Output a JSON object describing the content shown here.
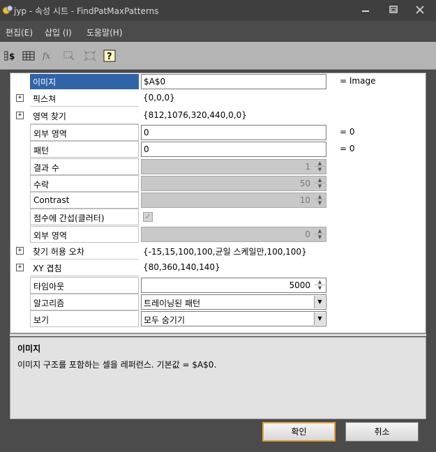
{
  "window": {
    "title": "jyp - 속성 시트 - FindPatMaxPatterns",
    "min_symbol": "─",
    "max_symbol": "▢",
    "close_symbol": "✕"
  },
  "menu": {
    "items": [
      {
        "label": "편집(E)"
      },
      {
        "label": "삽입 (I)"
      },
      {
        "label": "도움말(H)"
      }
    ]
  },
  "toolbar": {
    "buttons": [
      {
        "icon": "cell-reference-icon",
        "glyph": "$"
      },
      {
        "icon": "grid-icon",
        "glyph": "▦"
      },
      {
        "icon": "function-icon",
        "glyph": "ƒx"
      },
      {
        "icon": "select-region-icon",
        "glyph": "⬚"
      },
      {
        "icon": "fit-region-icon",
        "glyph": "⌗"
      },
      {
        "icon": "help-icon",
        "glyph": "?"
      }
    ]
  },
  "rows": [
    {
      "label": "이미지",
      "value": "$A$0",
      "unit": "= Image",
      "kind": "input",
      "selected": true
    },
    {
      "label": "픽스쳐",
      "value": "{0,0,0}",
      "kind": "plain",
      "expandable": true
    },
    {
      "label": "영역 찾기",
      "value": "{812,1076,320,440,0,0}",
      "kind": "plain",
      "expandable": true
    },
    {
      "label": "외부 영역",
      "value": "0",
      "unit": "= 0",
      "kind": "input"
    },
    {
      "label": "패턴",
      "value": "0",
      "unit": "= 0",
      "kind": "input"
    },
    {
      "label": "결과 수",
      "value": "1",
      "kind": "spin-disabled"
    },
    {
      "label": "수락",
      "value": "50",
      "kind": "spin-disabled"
    },
    {
      "label": "Contrast",
      "value": "10",
      "kind": "spin-disabled"
    },
    {
      "label": "점수에 간섭(클러터)",
      "value": "",
      "kind": "checkbox",
      "checked": true
    },
    {
      "label": "외부 영역",
      "value": "0",
      "kind": "spin-disabled"
    },
    {
      "label": "찾기 허용 오차",
      "value": "{-15,15,100,100,균일 스케일만,100,100}",
      "kind": "plain",
      "expandable": true
    },
    {
      "label": "XY 겹침",
      "value": "{80,360,140,140}",
      "kind": "plain",
      "expandable": true
    },
    {
      "label": "타임아웃",
      "value": "5000",
      "kind": "spin"
    },
    {
      "label": "알고리즘",
      "value": "트레이닝된 패턴",
      "kind": "dropdown"
    },
    {
      "label": "보기",
      "value": "모두 숨기기",
      "kind": "dropdown"
    }
  ],
  "description": {
    "title": "이미지",
    "text": "이미지 구조를 포함하는 셀을 레퍼런스. 기본값 = $A$0."
  },
  "buttons": {
    "ok": "확인",
    "cancel": "취소"
  },
  "symbols": {
    "expand": "+",
    "spin_up": "▲",
    "spin_down": "▼",
    "dropdown": "▼",
    "check": "✓"
  },
  "colors": {
    "selection": "#3064a8",
    "titlebar": "#3f3f3f",
    "ok_border": "#e0a030"
  }
}
